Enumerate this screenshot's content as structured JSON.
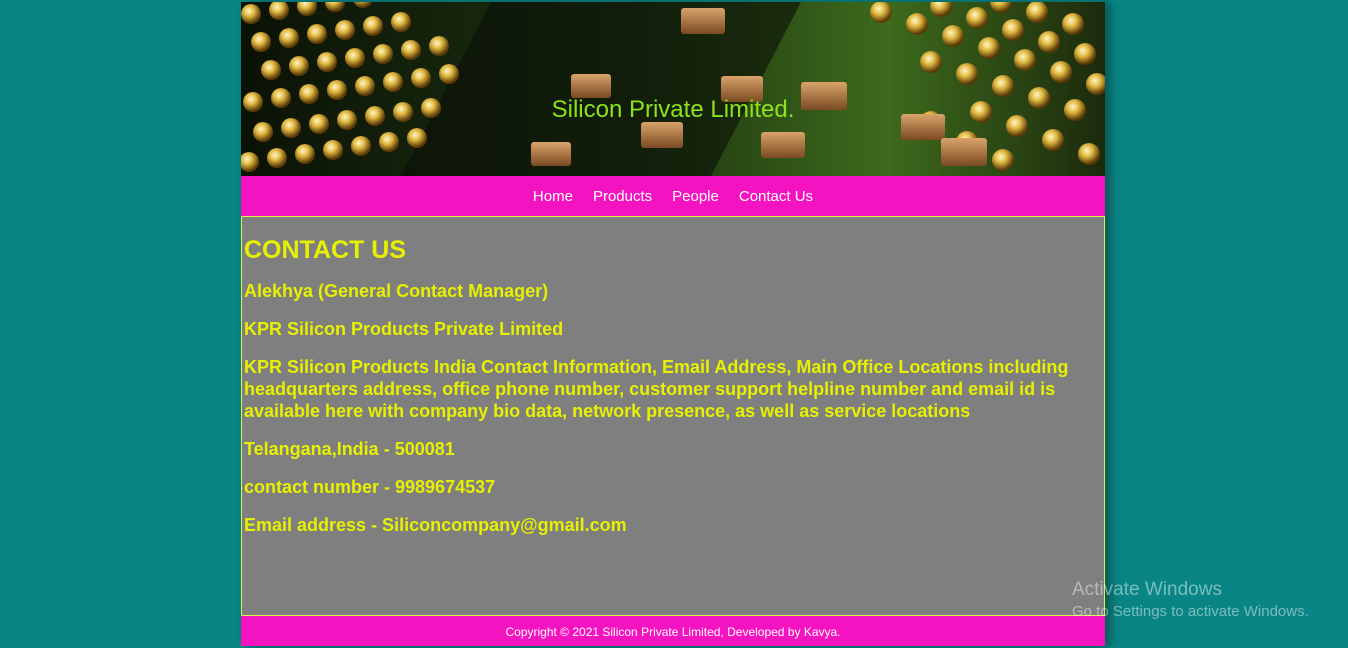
{
  "banner": {
    "title": "Silicon Private Limited."
  },
  "nav": {
    "items": [
      "Home",
      "Products",
      "People",
      "Contact Us"
    ]
  },
  "content": {
    "heading": "CONTACT US",
    "manager": "Alekhya (General Contact Manager)",
    "company": "KPR Silicon Products Private Limited",
    "description": "KPR Silicon Products India Contact Information, Email Address, Main Office Locations including headquarters address, office phone number, customer support helpline number and email id is available here with company bio data, network presence, as well as service locations",
    "address": "Telangana,India - 500081",
    "phone": "contact number - 9989674537",
    "email": "Email address - Siliconcompany@gmail.com"
  },
  "footer": {
    "text": "Copyright © 2021 Silicon Private Limited, Developed by Kavya."
  },
  "watermark": {
    "title": "Activate Windows",
    "subtitle": "Go to Settings to activate Windows."
  },
  "colors": {
    "background": "#0a8585",
    "nav": "#f413c0",
    "content_bg": "#7f7f7f",
    "content_text": "#e6f000",
    "banner_title": "#8ee21a"
  }
}
